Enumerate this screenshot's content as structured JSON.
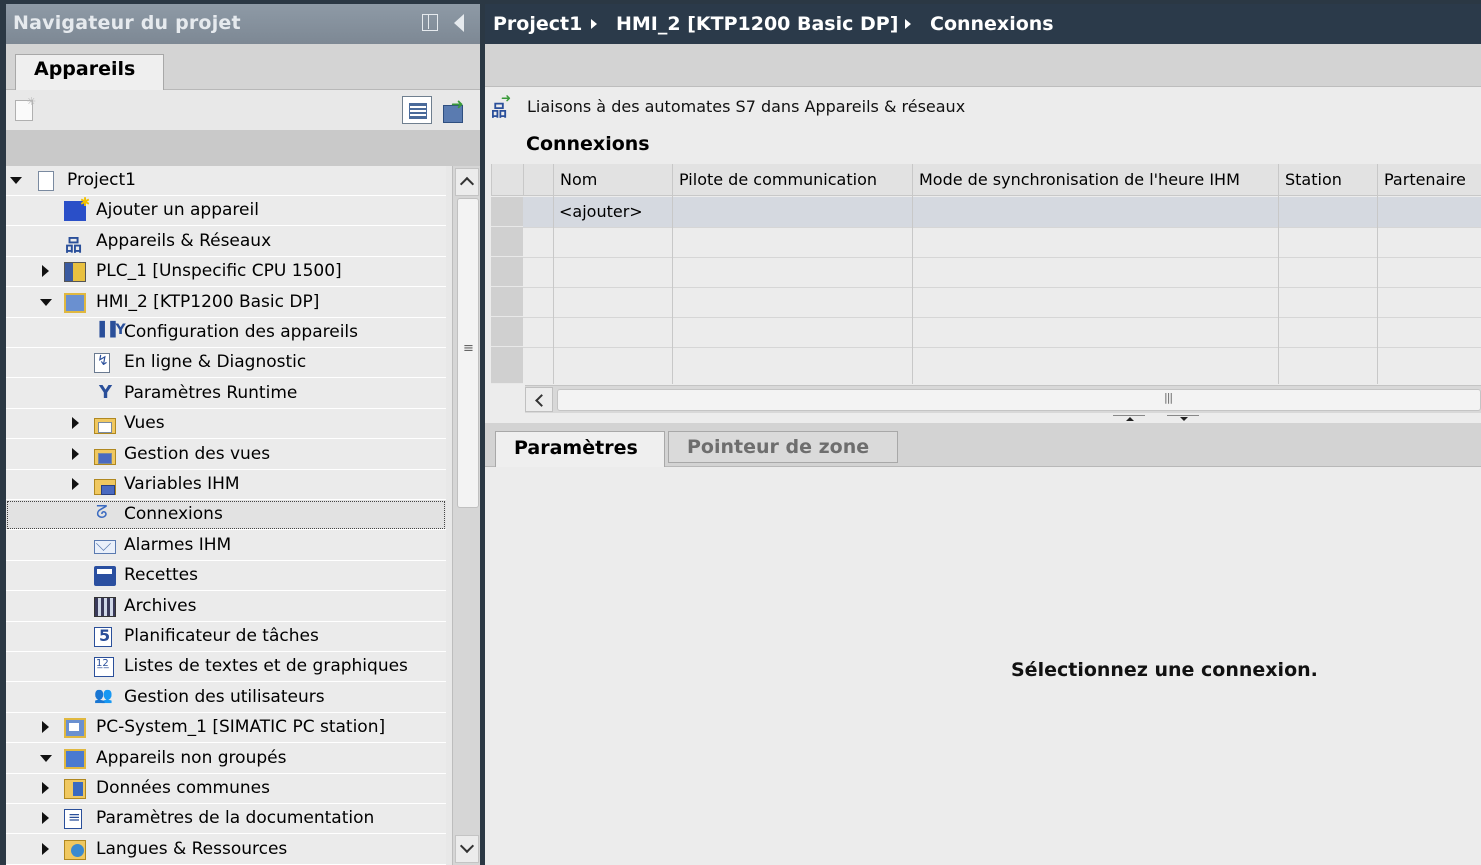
{
  "navigator": {
    "title": "Navigateur du projet",
    "tab": "Appareils",
    "tree": [
      {
        "label": "Project1",
        "icon": "project-icon",
        "expander": "open",
        "level": 0
      },
      {
        "label": "Ajouter un appareil",
        "icon": "add-device-icon",
        "expander": "none",
        "level": 1
      },
      {
        "label": "Appareils & Réseaux",
        "icon": "network-icon",
        "expander": "none",
        "level": 1
      },
      {
        "label": "PLC_1 [Unspecific CPU 1500]",
        "icon": "plc-icon",
        "expander": "closed",
        "level": 1
      },
      {
        "label": "HMI_2 [KTP1200 Basic DP]",
        "icon": "hmi-icon",
        "expander": "open",
        "level": 1
      },
      {
        "label": "Configuration des appareils",
        "icon": "device-config-icon",
        "expander": "none",
        "level": 2
      },
      {
        "label": "En ligne & Diagnostic",
        "icon": "diagnostic-icon",
        "expander": "none",
        "level": 2
      },
      {
        "label": "Paramètres Runtime",
        "icon": "runtime-settings-icon",
        "expander": "none",
        "level": 2
      },
      {
        "label": "Vues",
        "icon": "folder-icon",
        "expander": "closed",
        "level": 2
      },
      {
        "label": "Gestion des vues",
        "icon": "screen-management-icon",
        "expander": "closed",
        "level": 2
      },
      {
        "label": "Variables IHM",
        "icon": "hmi-tags-icon",
        "expander": "closed",
        "level": 2
      },
      {
        "label": "Connexions",
        "icon": "connections-icon",
        "expander": "none",
        "level": 2,
        "selected": true
      },
      {
        "label": "Alarmes IHM",
        "icon": "alarms-icon",
        "expander": "none",
        "level": 2
      },
      {
        "label": "Recettes",
        "icon": "recipes-icon",
        "expander": "none",
        "level": 2
      },
      {
        "label": "Archives",
        "icon": "archives-icon",
        "expander": "none",
        "level": 2
      },
      {
        "label": "Planificateur de tâches",
        "icon": "scheduler-icon",
        "expander": "none",
        "level": 2
      },
      {
        "label": "Listes de textes et de graphiques",
        "icon": "text-graphic-lists-icon",
        "expander": "none",
        "level": 2
      },
      {
        "label": "Gestion des utilisateurs",
        "icon": "user-admin-icon",
        "expander": "none",
        "level": 2
      },
      {
        "label": "PC-System_1 [SIMATIC PC station]",
        "icon": "pc-station-icon",
        "expander": "closed",
        "level": 1
      },
      {
        "label": "Appareils non groupés",
        "icon": "ungrouped-devices-icon",
        "expander": "open",
        "level": 1
      },
      {
        "label": "Données communes",
        "icon": "common-data-icon",
        "expander": "closed",
        "level": 1
      },
      {
        "label": "Paramètres de la documentation",
        "icon": "documentation-settings-icon",
        "expander": "closed",
        "level": 1
      },
      {
        "label": "Langues & Ressources",
        "icon": "languages-icon",
        "expander": "closed",
        "level": 1
      }
    ]
  },
  "breadcrumb": [
    "Project1",
    "HMI_2 [KTP1200 Basic DP]",
    "Connexions"
  ],
  "editor": {
    "link_text": "Liaisons à des automates S7 dans Appareils & réseaux",
    "section_title": "Connexions",
    "columns": [
      "Nom",
      "Pilote de communication",
      "Mode de synchronisation de l'heure IHM",
      "Station",
      "Partenaire"
    ],
    "add_row_label": "<ajouter>",
    "tabs": {
      "parameters": "Paramètres",
      "area_pointer": "Pointeur de zone"
    },
    "hint": "Sélectionnez une connexion."
  }
}
